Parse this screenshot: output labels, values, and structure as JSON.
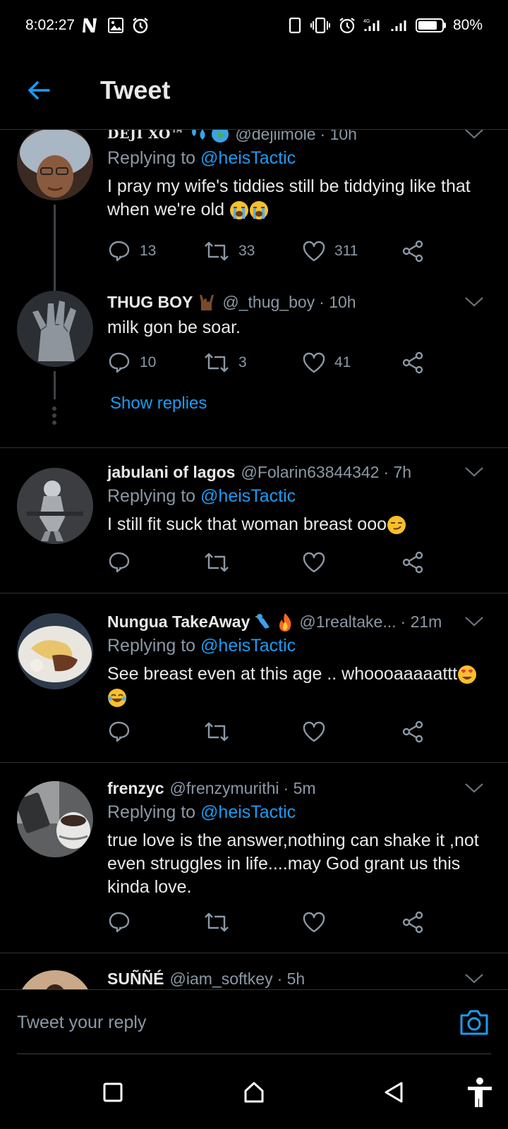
{
  "status_bar": {
    "time": "8:02:27",
    "battery": "80%",
    "battery_level": 0.8,
    "icons": [
      "netflix-icon",
      "gallery-icon",
      "alarm-icon",
      "vibrate-icon",
      "alarm-icon",
      "signal-icon",
      "signal-icon",
      "battery-icon"
    ]
  },
  "header": {
    "title": "Tweet",
    "back_icon": "arrow-left-icon"
  },
  "colors": {
    "accent": "#1d9bf0",
    "background": "#000000",
    "secondary_text": "#8b98a5",
    "divider": "#2f3336"
  },
  "tweets": [
    {
      "name": "DEJI XO™",
      "emojis": [
        "sweat-droplets",
        "globe"
      ],
      "handle": "@dejiimole",
      "time": "· 10h",
      "replying_prefix": "Replying to ",
      "replying_to": "@heisTactic",
      "text": "I pray my wife's tiddies still be tiddying like that when we're old",
      "text_emojis": [
        "loudly-crying-face",
        "loudly-crying-face"
      ],
      "replies": "13",
      "retweets": "33",
      "likes": "311"
    },
    {
      "name": "THUG BOY",
      "emojis": [
        "sign-of-horns-dark"
      ],
      "handle": "@_thug_boy",
      "time": "· 10h",
      "text": "milk gon be soar.",
      "replies": "10",
      "retweets": "3",
      "likes": "41",
      "show_replies": "Show replies"
    },
    {
      "name": "jabulani of lagos",
      "handle": "@Folarin63844342",
      "time": "· 7h",
      "replying_prefix": "Replying to ",
      "replying_to": "@heisTactic",
      "text": "I still fit suck that woman breast ooo",
      "text_emojis": [
        "smirking-face"
      ]
    },
    {
      "name": "Nungua TakeAway",
      "emojis": [
        "bird",
        "fire"
      ],
      "handle": "@1realtake...",
      "time": "· 21m",
      "replying_prefix": "Replying to ",
      "replying_to": "@heisTactic",
      "text": "See breast even at this age .. whoooaaaaattt",
      "text_emojis": [
        "heart-eyes-face",
        "tears-of-joy-face"
      ]
    },
    {
      "name": "frenzyc",
      "handle": "@frenzymurithi",
      "time": "· 5m",
      "replying_prefix": "Replying to ",
      "replying_to": "@heisTactic",
      "text": "true love is the answer,nothing can shake it ,not even struggles in life....may God grant us this kinda love."
    },
    {
      "name": "SUÑÑÉ",
      "handle": "@iam_softkey",
      "time": "· 5h"
    }
  ],
  "reply_bar": {
    "placeholder": "Tweet your reply",
    "camera_icon": "camera-icon"
  },
  "nav_bar": {
    "icons": [
      "recents-square-icon",
      "home-icon",
      "back-triangle-icon",
      "accessibility-icon"
    ]
  }
}
